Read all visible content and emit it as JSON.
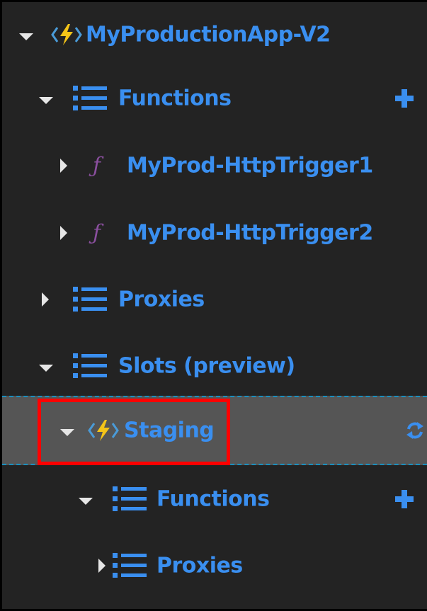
{
  "tree": {
    "root": {
      "label": "MyProductionApp-V2",
      "icon": "function-app-bolt-icon",
      "expanded": true
    },
    "functions": {
      "label": "Functions",
      "icon": "list-icon",
      "expanded": true,
      "action_icon": "plus-icon"
    },
    "function_items": [
      {
        "label": "MyProd-HttpTrigger1",
        "icon": "function-f-icon",
        "expanded": false
      },
      {
        "label": "MyProd-HttpTrigger2",
        "icon": "function-f-icon",
        "expanded": false
      }
    ],
    "proxies": {
      "label": "Proxies",
      "icon": "list-icon",
      "expanded": false
    },
    "slots": {
      "label": "Slots (preview)",
      "icon": "list-icon",
      "expanded": true
    },
    "staging": {
      "label": "Staging",
      "icon": "function-app-bolt-icon",
      "expanded": true,
      "selected": true,
      "action_icon": "refresh-icon"
    },
    "staging_functions": {
      "label": "Functions",
      "icon": "list-icon",
      "expanded": true,
      "action_icon": "plus-icon"
    },
    "staging_proxies": {
      "label": "Proxies",
      "icon": "list-icon",
      "expanded": false
    }
  },
  "colors": {
    "background": "#232323",
    "label": "#3a8ff0",
    "selected_row": "#555555",
    "function_icon": "#8a4f9e",
    "bolt": "#f5c518",
    "highlight": "#ff0000"
  }
}
